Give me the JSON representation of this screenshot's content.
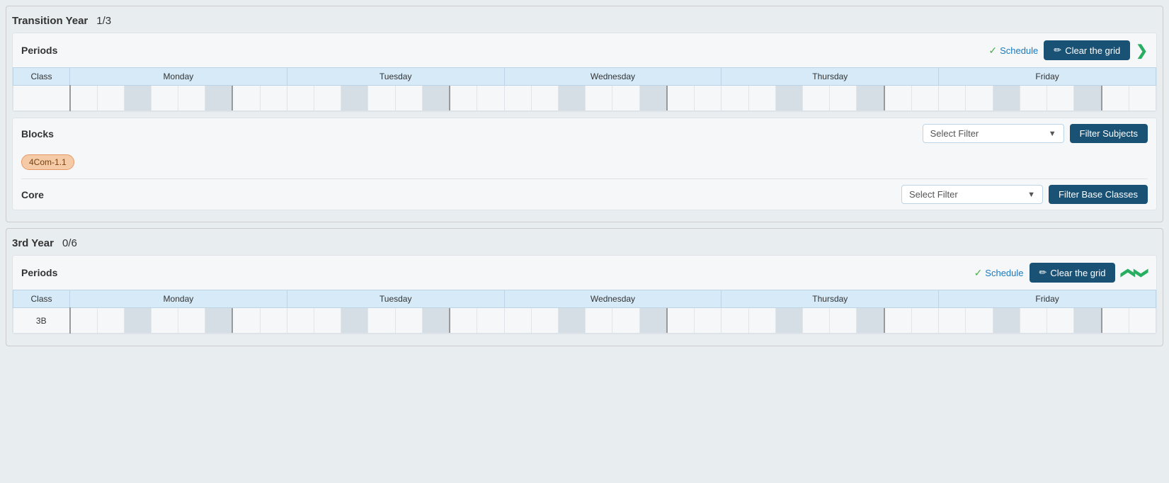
{
  "transitionYear": {
    "title": "Transition Year",
    "count": "1/3",
    "periods": {
      "label": "Periods",
      "scheduleLabel": "Schedule",
      "clearGridLabel": "Clear the grid",
      "columns": [
        "Class",
        "Monday",
        "Tuesday",
        "Wednesday",
        "Thursday",
        "Friday"
      ],
      "rows": []
    },
    "blocks": {
      "label": "Blocks",
      "filterPlaceholder": "Select Filter",
      "filterButtonLabel": "Filter Subjects",
      "items": [
        {
          "id": "4Com-1.1",
          "color": "#f5cba7"
        }
      ]
    },
    "core": {
      "label": "Core",
      "filterPlaceholder": "Select Filter",
      "filterButtonLabel": "Filter Base Classes"
    }
  },
  "thirdYear": {
    "title": "3rd Year",
    "count": "0/6",
    "periods": {
      "label": "Periods",
      "scheduleLabel": "Schedule",
      "clearGridLabel": "Clear the grid",
      "columns": [
        "Class",
        "Monday",
        "Tuesday",
        "Wednesday",
        "Thursday",
        "Friday"
      ],
      "rows": [
        {
          "class": "3B"
        }
      ]
    }
  },
  "icons": {
    "checkmark": "✓",
    "pencil": "✏",
    "chevronDown": "❯",
    "chevronUp": "❮",
    "dropdownArrow": "▼"
  }
}
